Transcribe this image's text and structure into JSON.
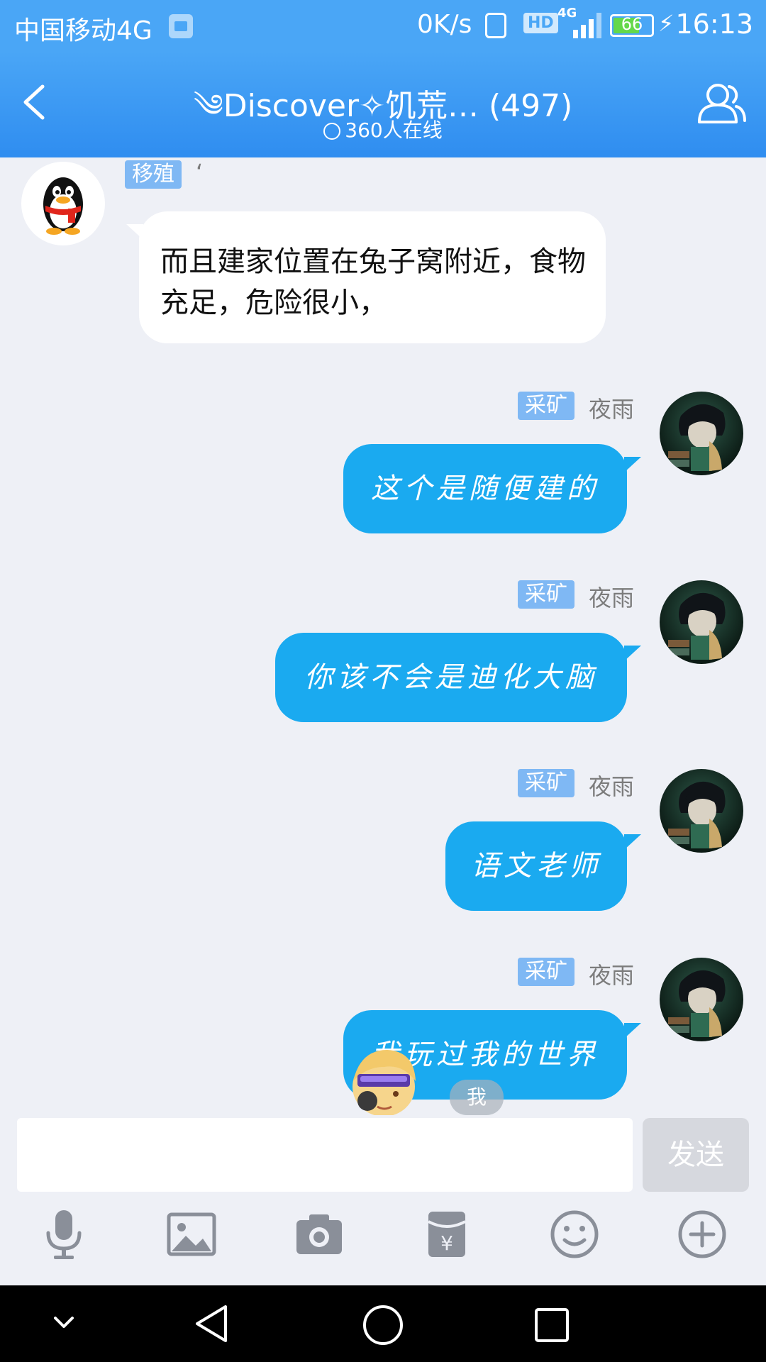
{
  "status_bar": {
    "carrier": "中国移动4G",
    "speed": "0K/s",
    "hd": "HD",
    "network": "4G",
    "battery": "66",
    "battery_level": 0.66,
    "time": "16:13"
  },
  "header": {
    "title": "༄Discover✧饥荒… (497)",
    "online": "360人在线"
  },
  "messages": [
    {
      "side": "left",
      "tag": "移殖",
      "nick": "‘",
      "text": "而且建家位置在兔子窝附近，食物充足，危险很小，",
      "avatar": "qq-penguin"
    },
    {
      "side": "right",
      "tag": "采矿",
      "nick": "夜雨",
      "text": "这个是随便建的",
      "avatar": "anime-boy"
    },
    {
      "side": "right",
      "tag": "采矿",
      "nick": "夜雨",
      "text": "你该不会是迪化大脑",
      "avatar": "anime-boy"
    },
    {
      "side": "right",
      "tag": "采矿",
      "nick": "夜雨",
      "text": "语文老师",
      "avatar": "anime-boy"
    },
    {
      "side": "right",
      "tag": "采矿",
      "nick": "夜雨",
      "text": "我玩过我的世界",
      "avatar": "anime-boy"
    }
  ],
  "overlay": {
    "me_label": "我"
  },
  "input": {
    "placeholder": "",
    "send_label": "发送"
  },
  "toolbar": [
    "microphone-icon",
    "image-icon",
    "camera-icon",
    "red-packet-icon",
    "emoji-icon",
    "plus-icon"
  ],
  "colors": {
    "header": "#3d9af3",
    "bubble_self": "#1aaaf0",
    "tag": "#7fb8f4",
    "background": "#eef0f6"
  }
}
